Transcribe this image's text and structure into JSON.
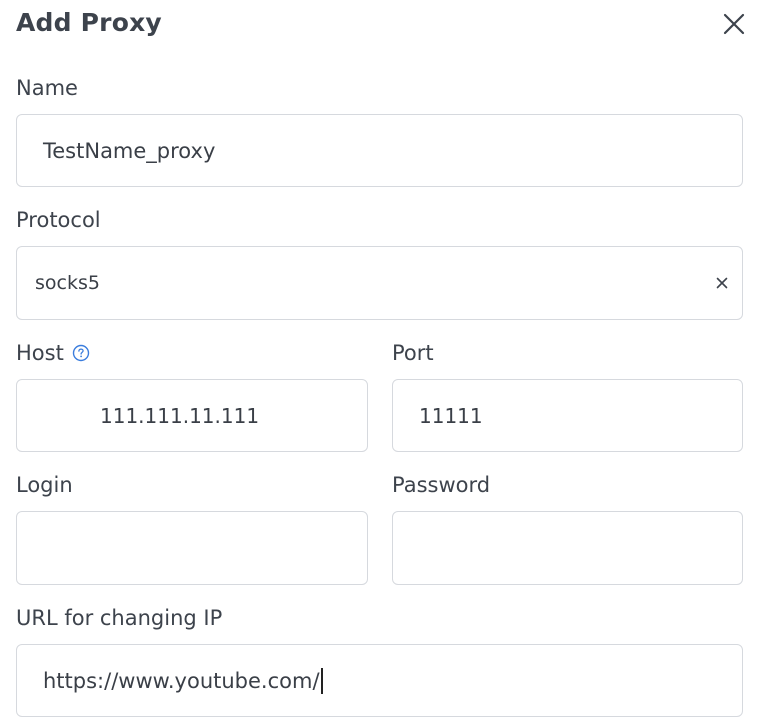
{
  "dialog": {
    "title": "Add Proxy"
  },
  "fields": {
    "name": {
      "label": "Name",
      "value": "TestName_proxy"
    },
    "protocol": {
      "label": "Protocol",
      "value": "socks5"
    },
    "host": {
      "label": "Host",
      "value": "111.111.11.111"
    },
    "port": {
      "label": "Port",
      "value": "11111"
    },
    "login": {
      "label": "Login",
      "value": ""
    },
    "password": {
      "label": "Password",
      "value": ""
    },
    "change_ip_url": {
      "label": "URL for changing IP",
      "value": "https://www.youtube.com/"
    }
  },
  "icons": {
    "close": "close-icon",
    "help": "help-circle-icon",
    "clear": "clear-icon"
  },
  "colors": {
    "accent": "#3b7ddd",
    "border": "#d6d9de",
    "text": "#3d434c"
  }
}
